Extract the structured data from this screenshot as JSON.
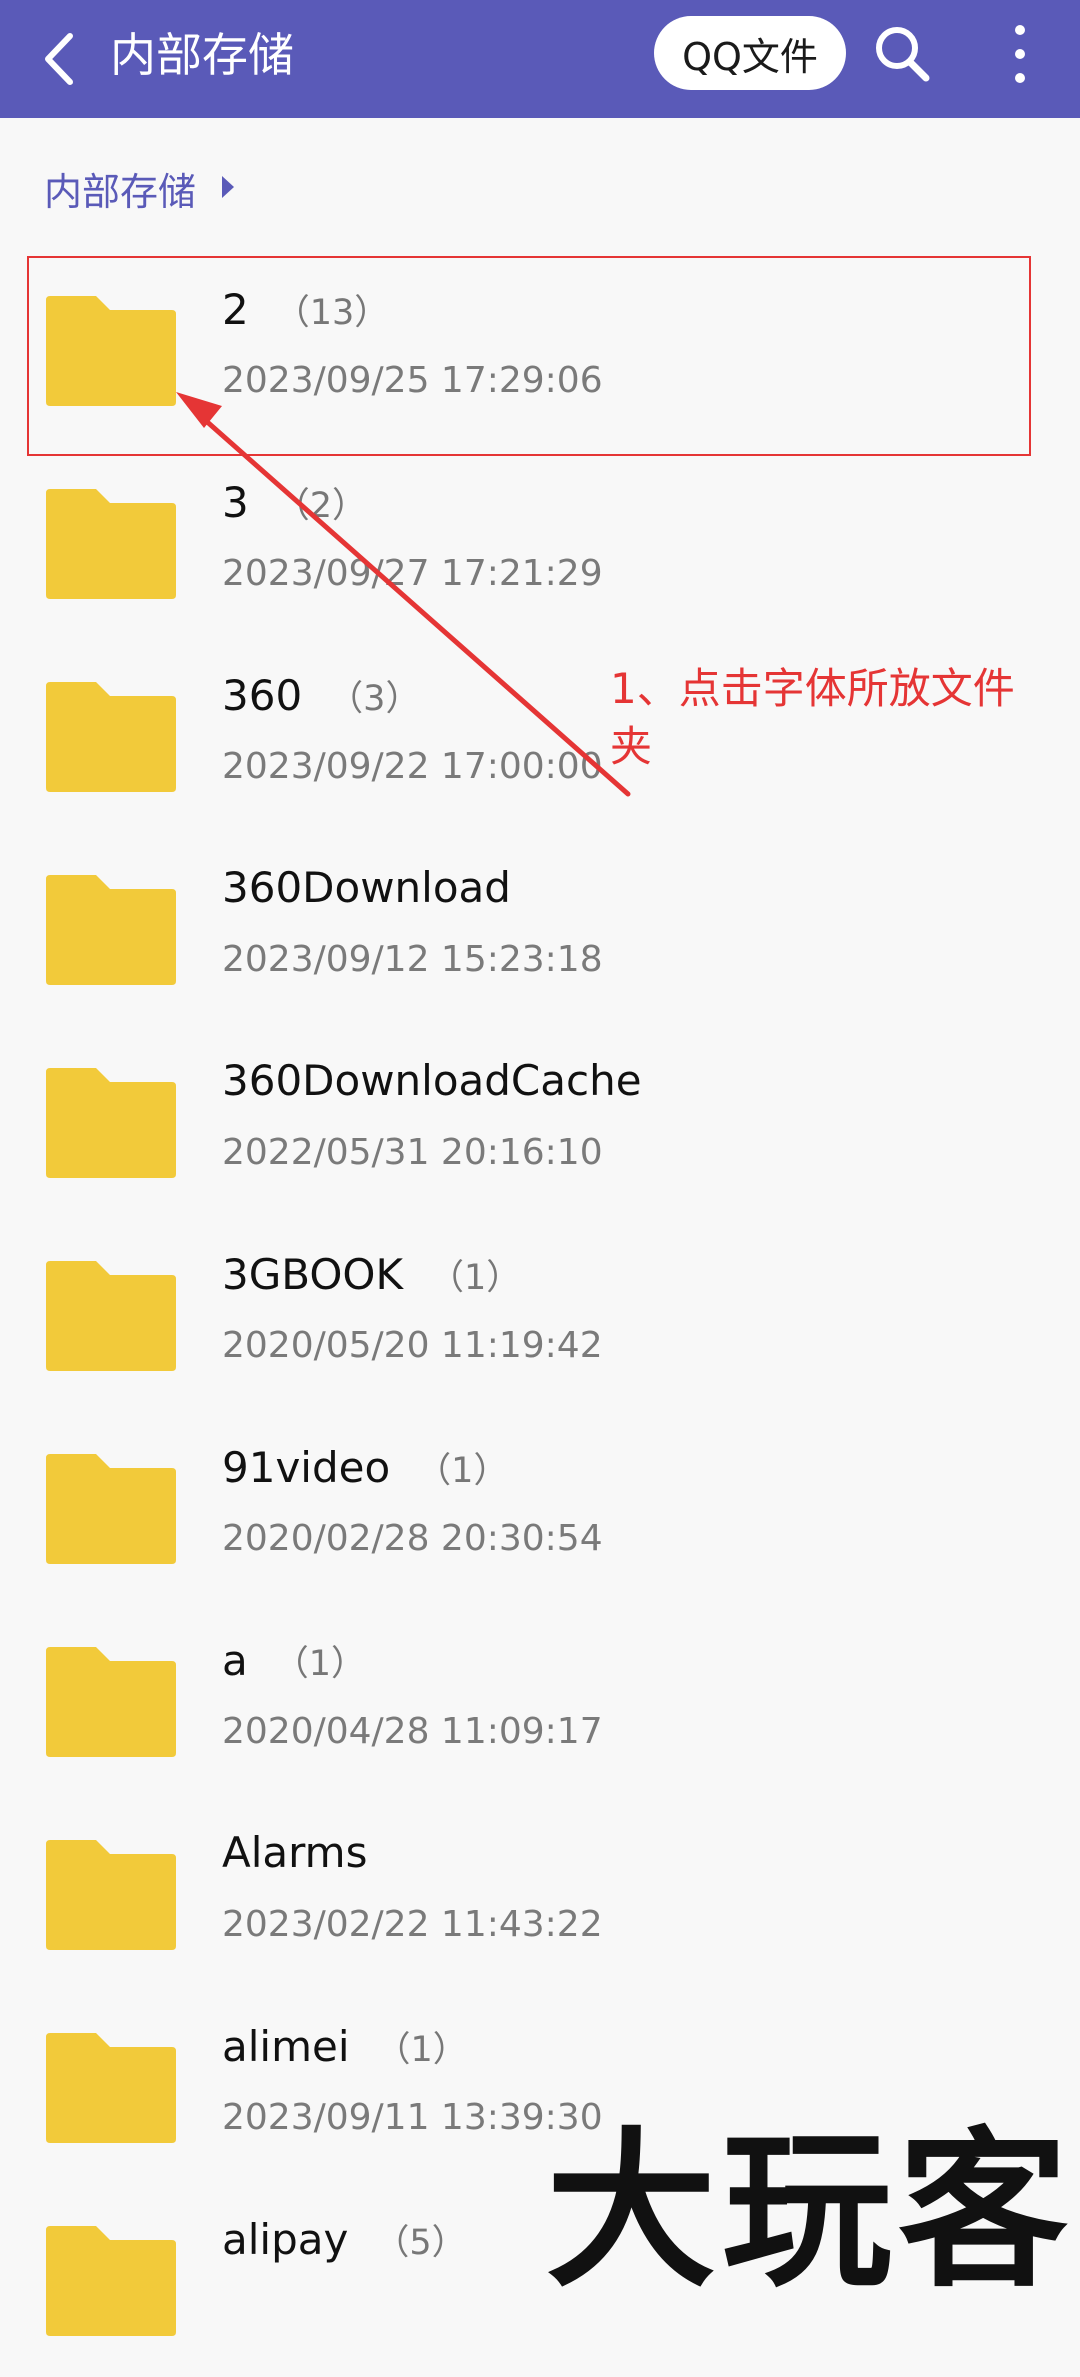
{
  "header": {
    "title": "内部存储",
    "qq_button": "QQ文件",
    "back_icon": "back-arrow-icon",
    "search_icon": "search-icon",
    "more_icon": "more-vertical-icon",
    "bar_color": "#5a5ab8"
  },
  "breadcrumb": {
    "label": "内部存储",
    "arrow_icon": "caret-right-icon"
  },
  "folders": [
    {
      "name": "2",
      "count": "（13）",
      "date": "2023/09/25 17:29:06"
    },
    {
      "name": "3",
      "count": "（2）",
      "date": "2023/09/27 17:21:29"
    },
    {
      "name": "360",
      "count": "（3）",
      "date": "2023/09/22 17:00:00"
    },
    {
      "name": "360Download",
      "count": "",
      "date": "2023/09/12 15:23:18"
    },
    {
      "name": "360DownloadCache",
      "count": "",
      "date": "2022/05/31 20:16:10"
    },
    {
      "name": "3GBOOK",
      "count": "（1）",
      "date": "2020/05/20 11:19:42"
    },
    {
      "name": "91video",
      "count": "（1）",
      "date": "2020/02/28 20:30:54"
    },
    {
      "name": "a",
      "count": "（1）",
      "date": "2020/04/28 11:09:17"
    },
    {
      "name": "Alarms",
      "count": "",
      "date": "2023/02/22 11:43:22"
    },
    {
      "name": "alimei",
      "count": "（1）",
      "date": "2023/09/11 13:39:30"
    },
    {
      "name": "alipay",
      "count": "（5）",
      "date": ""
    }
  ],
  "annotation": {
    "text": "1、点击字体所放文件夹",
    "color": "#e53535"
  },
  "watermark": {
    "text": "大玩客"
  },
  "colors": {
    "folder": "#f2ca3a",
    "accent": "#5a5ab8",
    "annotation": "#e53535"
  }
}
